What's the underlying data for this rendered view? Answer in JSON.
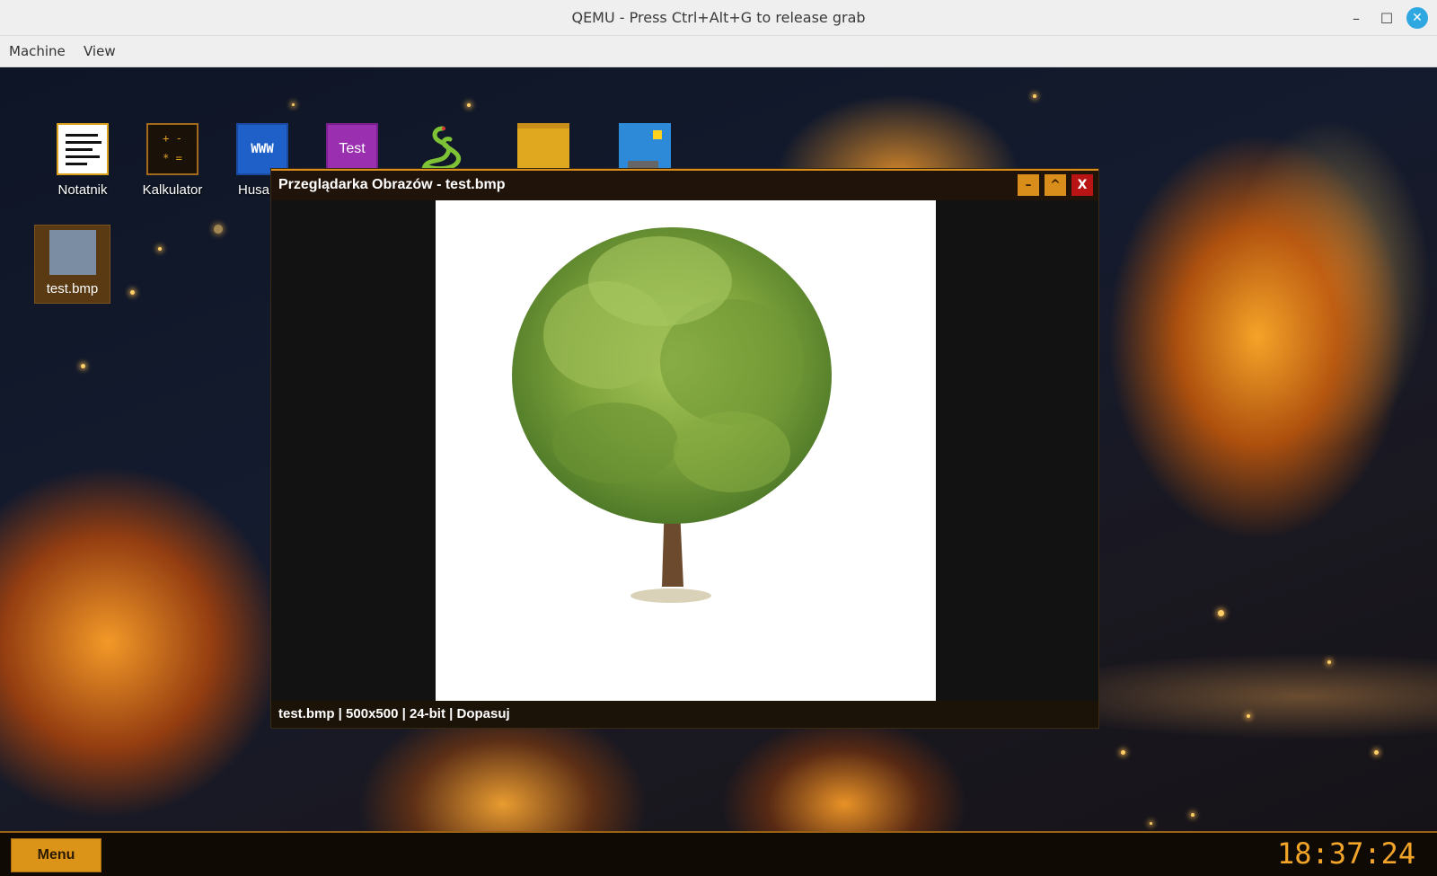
{
  "host": {
    "title": "QEMU - Press Ctrl+Alt+G to release grab",
    "menu": [
      "Machine",
      "View"
    ],
    "controls": {
      "minimize": "–",
      "maximize": "☐",
      "close": "✕"
    }
  },
  "desktop": {
    "icons": [
      {
        "label": "Notatnik",
        "icon": "notepad-icon"
      },
      {
        "label": "Kalkulator",
        "icon": "calculator-icon",
        "glyph": "+ -\n* ="
      },
      {
        "label": "Husa",
        "icon": "browser-icon",
        "glyph": "WWW"
      },
      {
        "label": "",
        "icon": "test-icon",
        "glyph": "Test"
      },
      {
        "label": "",
        "icon": "snake-icon"
      },
      {
        "label": "",
        "icon": "folder-icon"
      },
      {
        "label": "",
        "icon": "image-icon"
      }
    ],
    "file_icon": {
      "label": "test.bmp",
      "icon": "bitmap-file-icon"
    }
  },
  "app_window": {
    "title": "Przeglądarka Obrazów - test.bmp",
    "buttons": {
      "minimize": "–",
      "maximize": "^",
      "close": "X"
    },
    "status": "test.bmp | 500x500 | 24-bit | Dopasuj",
    "image_subject": "tree"
  },
  "taskbar": {
    "menu_label": "Menu",
    "clock": "18:37:24"
  },
  "colors": {
    "accent": "#dc9418",
    "close_red": "#b81414",
    "clock": "#f3a52a"
  }
}
